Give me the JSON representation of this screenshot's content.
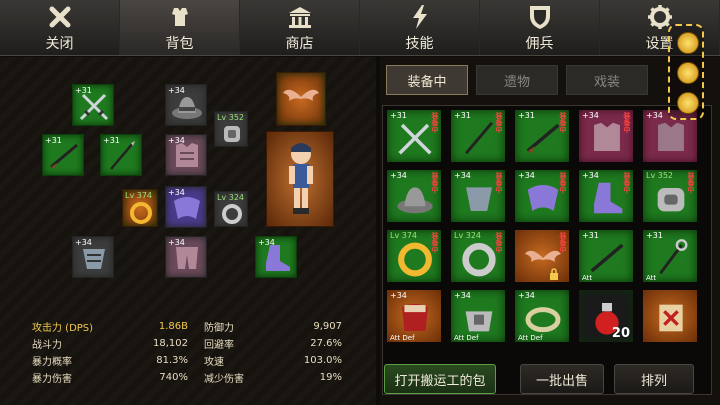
{
  "nav": {
    "tabs": [
      {
        "label": "关闭",
        "icon": "close-x-icon"
      },
      {
        "label": "背包",
        "icon": "armor-icon"
      },
      {
        "label": "商店",
        "icon": "shop-building-icon"
      },
      {
        "label": "技能",
        "icon": "lightning-icon"
      },
      {
        "label": "佣兵",
        "icon": "shield-icon"
      },
      {
        "label": "设置",
        "icon": "gear-icon"
      }
    ],
    "active": "背包"
  },
  "equipped": {
    "slots": [
      {
        "tag": "+31",
        "item": "crossed-swords"
      },
      {
        "tag": "+34",
        "item": "hat"
      },
      {
        "tag": "+31",
        "item": "musket"
      },
      {
        "tag": "+31",
        "item": "spear"
      },
      {
        "tag": "+34",
        "item": "armor"
      },
      {
        "tag": "Lv 352",
        "item": "bracer"
      },
      {
        "tag": "Lv 374",
        "item": "gold-ring"
      },
      {
        "tag": "+34",
        "item": "cape"
      },
      {
        "tag": "Lv 324",
        "item": "silver-ring"
      },
      {
        "tag": "+34",
        "item": "gauntlet"
      },
      {
        "tag": "+34",
        "item": "greaves"
      },
      {
        "tag": "+34",
        "item": "boots"
      },
      {
        "tag": "",
        "item": "wings"
      }
    ]
  },
  "stats": {
    "rows": [
      {
        "k1": "攻击力 (DPS)",
        "v1": "1.86B",
        "k2": "防御力",
        "v2": "9,907"
      },
      {
        "k1": "战斗力",
        "v1": "18,102",
        "k2": "回避率",
        "v2": "27.6%"
      },
      {
        "k1": "暴力概率",
        "v1": "81.3%",
        "k2": "攻速",
        "v2": "103.0%"
      },
      {
        "k1": "暴力伤害",
        "v1": "740%",
        "k2": "减少伤害",
        "v2": "19%"
      }
    ]
  },
  "inventory": {
    "tabs": [
      {
        "label": "装备中"
      },
      {
        "label": "遗物"
      },
      {
        "label": "戏装"
      }
    ],
    "equipped_tag": "装备中",
    "att": "Att",
    "att_def": "Att Def",
    "cells": [
      {
        "tag": "+31",
        "bg": "green",
        "item": "crossed-swords",
        "equipped": true
      },
      {
        "tag": "+31",
        "bg": "green",
        "item": "spear",
        "equipped": true
      },
      {
        "tag": "+31",
        "bg": "green",
        "item": "musket",
        "equipped": true
      },
      {
        "tag": "+34",
        "bg": "green",
        "item": "armor",
        "equipped": true
      },
      {
        "tag": "+34",
        "bg": "green",
        "item": "armor2",
        "equipped": false
      },
      {
        "tag": "+34",
        "bg": "green",
        "item": "hat",
        "equipped": true
      },
      {
        "tag": "+34",
        "bg": "green",
        "item": "gauntlet",
        "equipped": true
      },
      {
        "tag": "+34",
        "bg": "green",
        "item": "cape",
        "equipped": true
      },
      {
        "tag": "+34",
        "bg": "green",
        "item": "boots",
        "equipped": true
      },
      {
        "tag": "Lv 352",
        "bg": "green",
        "item": "bracer",
        "equipped": true
      },
      {
        "tag": "Lv 374",
        "bg": "green",
        "item": "gold-ring",
        "equipped": true
      },
      {
        "tag": "Lv 324",
        "bg": "green",
        "item": "silver-ring",
        "equipped": true
      },
      {
        "tag": "",
        "bg": "orange",
        "item": "wings",
        "equipped": true
      },
      {
        "tag": "+31",
        "bg": "green",
        "item": "musket",
        "equipped": false
      },
      {
        "tag": "+31",
        "bg": "green",
        "item": "staff",
        "equipped": false
      },
      {
        "tag": "+34",
        "bg": "orange",
        "item": "cape-red",
        "equipped": false
      },
      {
        "tag": "+34",
        "bg": "green",
        "item": "bracer2",
        "equipped": false
      },
      {
        "tag": "+34",
        "bg": "green",
        "item": "ring2",
        "equipped": false
      },
      {
        "tag": "",
        "bg": "green",
        "item": "potion",
        "count": "20",
        "equipped": false
      },
      {
        "tag": "",
        "bg": "orange",
        "item": "scroll",
        "equipped": false
      }
    ]
  },
  "buttons": {
    "open_bag": "打开搬运工的包",
    "bulk_sell": "一批出售",
    "sort": "排列"
  },
  "colors": {
    "green_slot": "#1f7a1f",
    "orange_slot": "#c76a20",
    "highlight": "#f2c94c"
  }
}
